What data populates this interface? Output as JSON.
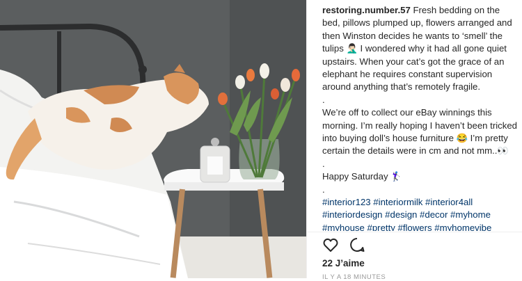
{
  "post": {
    "username": "restoring.number.57",
    "caption_p1": "Fresh bedding on the bed, pillows plumped up, flowers arranged and then Winston decides he wants to ‘smell’ the tulips 🤦🏻‍♂️ I wondered why it had all gone quiet upstairs. When your cat’s got the grace of an elephant he requires constant supervision around anything that’s remotely fragile.",
    "dot": ".",
    "caption_p2": "We’re off to collect our eBay winnings this morning. I’m really hoping I haven’t been tricked into buying doll’s house furniture 😂 I’m pretty certain the details were in cm and not mm..👀",
    "caption_p3": "Happy Saturday 🏌🏻‍♀️",
    "hashtags": "#interior123 #interiormilk #interior4all #interiordesign #design #decor #myhome #myhouse #pretty #flowers #myhomevibe"
  },
  "actions": {
    "like_icon": "heart-icon",
    "comment_icon": "comment-bubble-icon"
  },
  "likes": "22 J’aime",
  "timestamp": "IL Y A 18 MINUTES"
}
